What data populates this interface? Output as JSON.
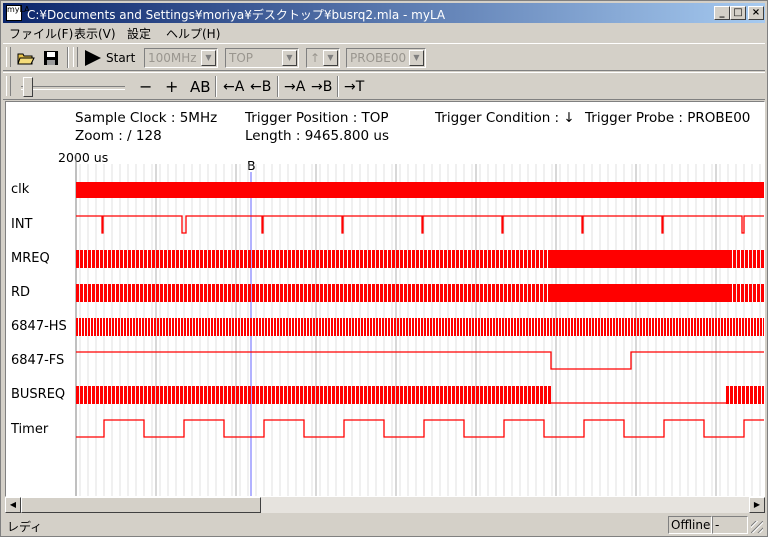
{
  "window": {
    "title": "C:¥Documents and Settings¥moriya¥デスクトップ¥busrq2.mla - myLA"
  },
  "titlebar": {
    "minimize": "_",
    "maximize": "□",
    "close": "×"
  },
  "menu": [
    {
      "label": "ファイル(F)"
    },
    {
      "label": "表示(V)"
    },
    {
      "label": "設定"
    },
    {
      "label": "ヘルプ(H)"
    }
  ],
  "toolbar": {
    "start_label": "Start",
    "clock": {
      "selected": "100MHz"
    },
    "position": {
      "selected": "TOP"
    },
    "edge": {
      "selected": "↑"
    },
    "probe": {
      "selected": "PROBE00"
    },
    "minus": "−",
    "plus": "+",
    "ab": "AB",
    "goto_a": "←A",
    "goto_b": "←B",
    "to_a": "→A",
    "to_b": "→B",
    "to_t": "→T"
  },
  "info": {
    "sample_clock": "Sample Clock : 5MHz",
    "zoom": "Zoom : / 128",
    "trigger_position": "Trigger Position : TOP",
    "length": "Length : 9465.800 us",
    "trigger_condition": "Trigger Condition : ↓",
    "trigger_probe": "Trigger Probe : PROBE00"
  },
  "time_label": "2000 us",
  "marker_label": "B",
  "signals": [
    {
      "name": "clk"
    },
    {
      "name": "INT"
    },
    {
      "name": "MREQ"
    },
    {
      "name": "RD"
    },
    {
      "name": "6847-HS"
    },
    {
      "name": "6847-FS"
    },
    {
      "name": "BUSREQ"
    },
    {
      "name": "Timer"
    }
  ],
  "colors": {
    "trace": "#ff0000",
    "grid_major": "#b0b0b0",
    "grid_minor": "#e2e2e2",
    "marker": "#6464ff"
  },
  "status": {
    "text": "レディ",
    "mode": "Offline",
    "extra": "-"
  }
}
